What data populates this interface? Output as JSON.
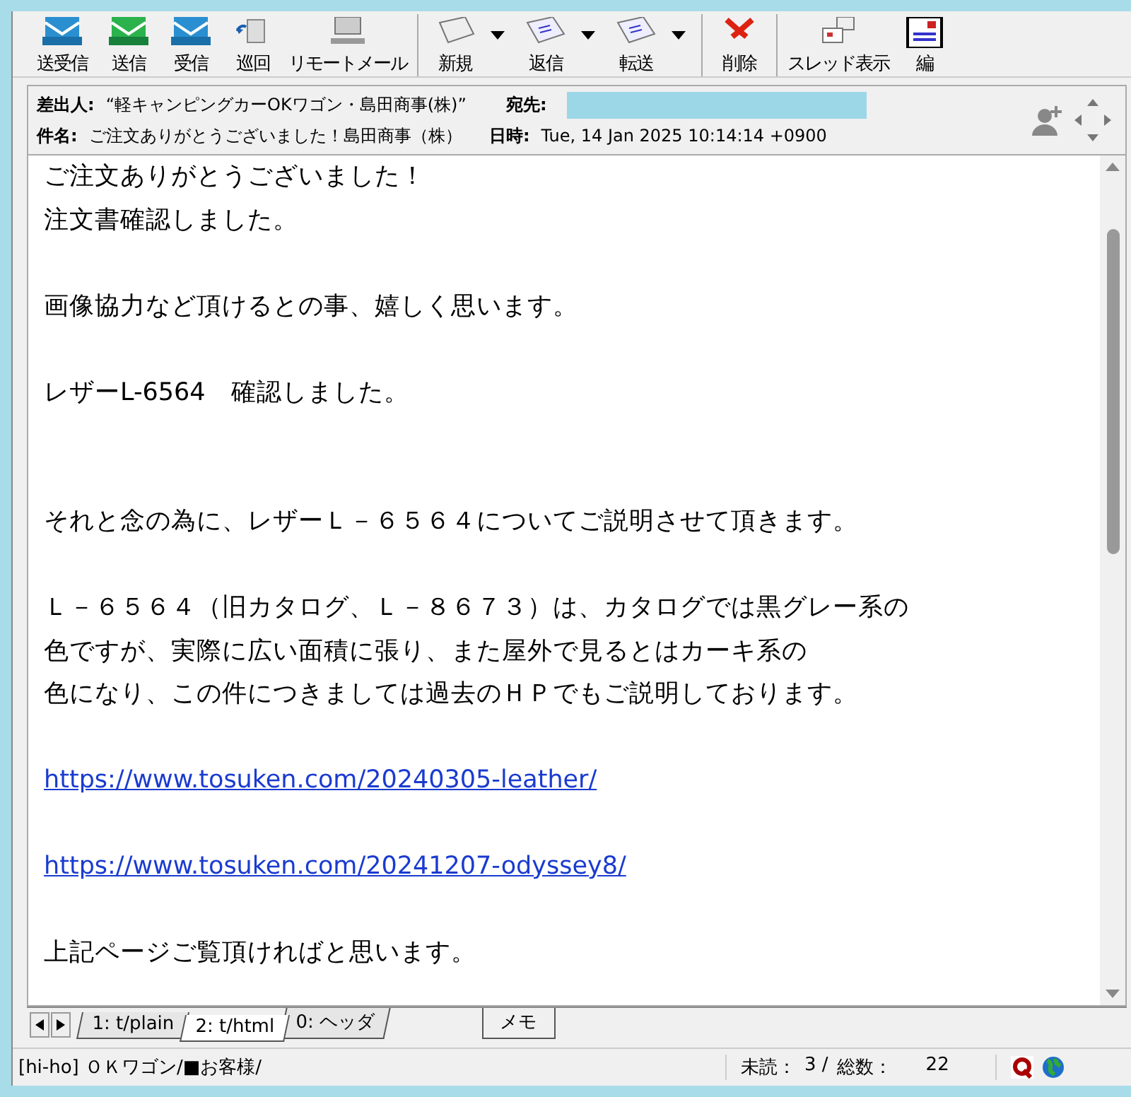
{
  "toolbar": {
    "groups": [
      [
        {
          "label": "送受信",
          "kind": "tray-blue",
          "dropdown": false
        },
        {
          "label": "送信",
          "kind": "tray-green",
          "dropdown": false
        },
        {
          "label": "受信",
          "kind": "tray-blue",
          "dropdown": false
        },
        {
          "label": "巡回",
          "kind": "patrol",
          "dropdown": false
        },
        {
          "label": "リモートメール",
          "kind": "remote",
          "dropdown": false
        }
      ],
      [
        {
          "label": "新規",
          "kind": "new",
          "dropdown": true
        },
        {
          "label": "返信",
          "kind": "reply",
          "dropdown": true
        },
        {
          "label": "転送",
          "kind": "forward",
          "dropdown": true
        }
      ],
      [
        {
          "label": "削除",
          "kind": "delete",
          "dropdown": false
        }
      ],
      [
        {
          "label": "スレッド表示",
          "kind": "thread",
          "dropdown": false
        },
        {
          "label": "編",
          "kind": "edit",
          "dropdown": false
        }
      ]
    ]
  },
  "header": {
    "from_label": "差出人:",
    "from": "“軽キャンピングカーOKワゴン・島田商事(株)”",
    "to_label": "宛先:",
    "subject_label": "件名:",
    "subject": "ご注文ありがとうございました！島田商事（株）",
    "date_label": "日時:",
    "date": "Tue, 14 Jan 2025 10:14:14 +0900"
  },
  "body": [
    {
      "kind": "text",
      "text": "ご注文ありがとうございました！"
    },
    {
      "kind": "text",
      "text": "注文書確認しました。"
    },
    {
      "kind": "blank"
    },
    {
      "kind": "text",
      "text": "画像協力など頂けるとの事、嬉しく思います。"
    },
    {
      "kind": "blank"
    },
    {
      "kind": "text",
      "text": "レザーL-6564　確認しました。"
    },
    {
      "kind": "blank"
    },
    {
      "kind": "blank"
    },
    {
      "kind": "text",
      "text": "それと念の為に、レザーＬ－６５６４についてご説明させて頂きます。"
    },
    {
      "kind": "blank"
    },
    {
      "kind": "text",
      "text": "Ｌ－６５６４（旧カタログ、Ｌ－８６７３）は、カタログでは黒グレー系の"
    },
    {
      "kind": "text",
      "text": "色ですが、実際に広い面積に張り、また屋外で見るとはカーキ系の"
    },
    {
      "kind": "text",
      "text": "色になり、この件につきましては過去のＨＰでもご説明しております。"
    },
    {
      "kind": "blank"
    },
    {
      "kind": "link",
      "text": "https://www.tosuken.com/20240305-leather/"
    },
    {
      "kind": "blank"
    },
    {
      "kind": "link",
      "text": "https://www.tosuken.com/20241207-odyssey8/"
    },
    {
      "kind": "blank"
    },
    {
      "kind": "text",
      "text": "上記ページご覧頂ければと思います。"
    }
  ],
  "tabs": [
    {
      "label": "1: t/plain",
      "selected": false
    },
    {
      "label": "2: t/html",
      "selected": true
    },
    {
      "label": "0: ヘッダ",
      "selected": false
    }
  ],
  "memo_button": "メモ",
  "status_bar": {
    "folder": "[hi-ho] ＯＫワゴン/■お客様/",
    "unread_label": "未読：",
    "unread": "3 /",
    "total_label": "総数：",
    "total": "22"
  }
}
